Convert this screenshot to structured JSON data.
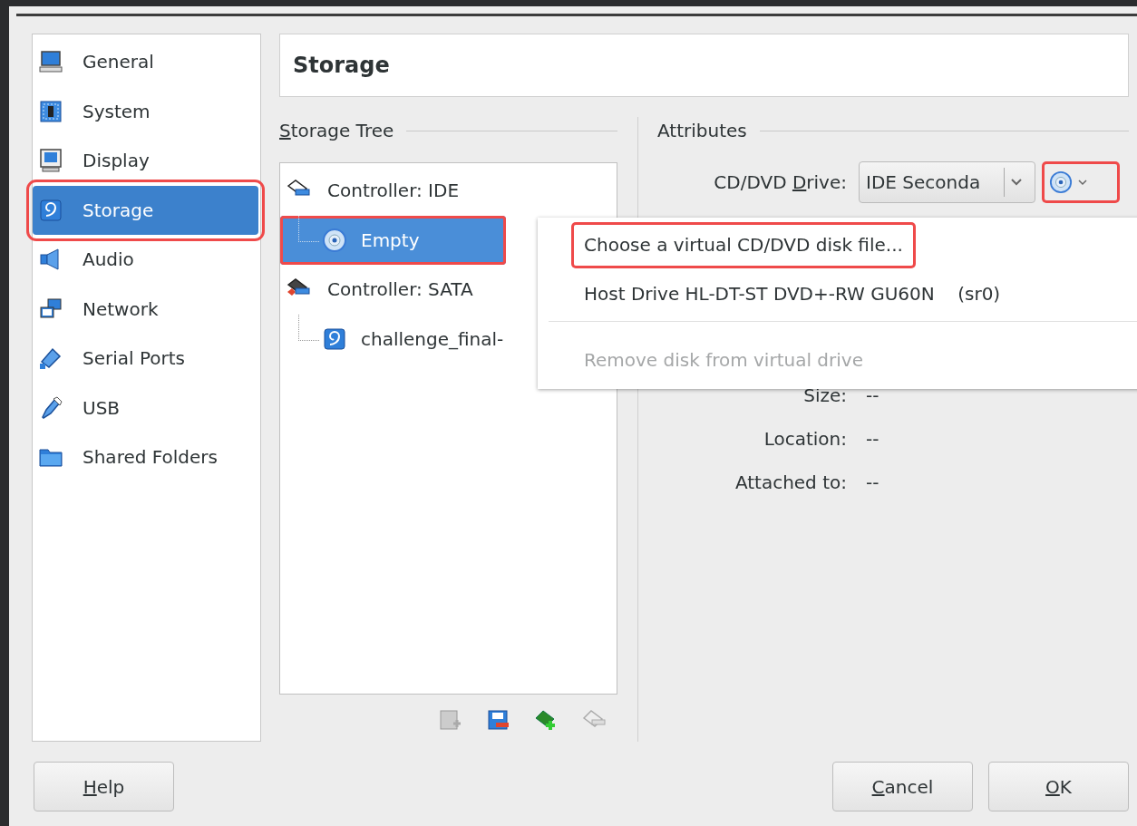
{
  "sidebar": {
    "items": [
      {
        "label": "General",
        "selected": false,
        "highlighted": false
      },
      {
        "label": "System",
        "selected": false,
        "highlighted": false
      },
      {
        "label": "Display",
        "selected": false,
        "highlighted": false
      },
      {
        "label": "Storage",
        "selected": true,
        "highlighted": true
      },
      {
        "label": "Audio",
        "selected": false,
        "highlighted": false
      },
      {
        "label": "Network",
        "selected": false,
        "highlighted": false
      },
      {
        "label": "Serial Ports",
        "selected": false,
        "highlighted": false
      },
      {
        "label": "USB",
        "selected": false,
        "highlighted": false
      },
      {
        "label": "Shared Folders",
        "selected": false,
        "highlighted": false
      }
    ]
  },
  "page_title": "Storage",
  "storage_tree": {
    "heading": {
      "key": "S",
      "rest": "torage Tree"
    },
    "items": [
      {
        "label": "Controller: IDE",
        "kind": "ide",
        "selected": false,
        "highlighted": false,
        "children": [
          {
            "label": "Empty",
            "kind": "optical",
            "selected": true,
            "highlighted": true
          }
        ]
      },
      {
        "label": "Controller: SATA",
        "kind": "sata",
        "selected": false,
        "highlighted": false,
        "children": [
          {
            "label": "challenge_final-",
            "kind": "disk",
            "selected": false,
            "highlighted": false
          }
        ]
      }
    ],
    "toolbar": [
      {
        "disabled": true
      },
      {
        "disabled": false
      },
      {
        "disabled": false
      },
      {
        "disabled": true
      }
    ]
  },
  "attributes": {
    "heading": "Attributes",
    "drive": {
      "label": {
        "pre": "CD/DVD ",
        "key": "D",
        "rest": "rive:"
      },
      "value": "IDE Seconda",
      "disc_button_highlighted": true
    },
    "info": [
      {
        "label": "Size:",
        "value": "--"
      },
      {
        "label": "Location:",
        "value": "--"
      },
      {
        "label": "Attached to:",
        "value": "--"
      }
    ]
  },
  "menu": {
    "items": [
      {
        "label": "Choose a virtual CD/DVD disk file...",
        "kind": "item",
        "disabled": false,
        "highlighted": true
      },
      {
        "label": "Host Drive HL-DT-ST DVD+-RW GU60N    (sr0)",
        "kind": "item",
        "disabled": false,
        "highlighted": false
      },
      {
        "kind": "separator"
      },
      {
        "label": "Remove disk from virtual drive",
        "kind": "item",
        "disabled": true,
        "highlighted": false
      }
    ]
  },
  "buttons": [
    {
      "key": "H",
      "rest": "elp"
    },
    {
      "key": "C",
      "rest": "ancel"
    },
    {
      "key": "O",
      "rest": "K"
    }
  ]
}
